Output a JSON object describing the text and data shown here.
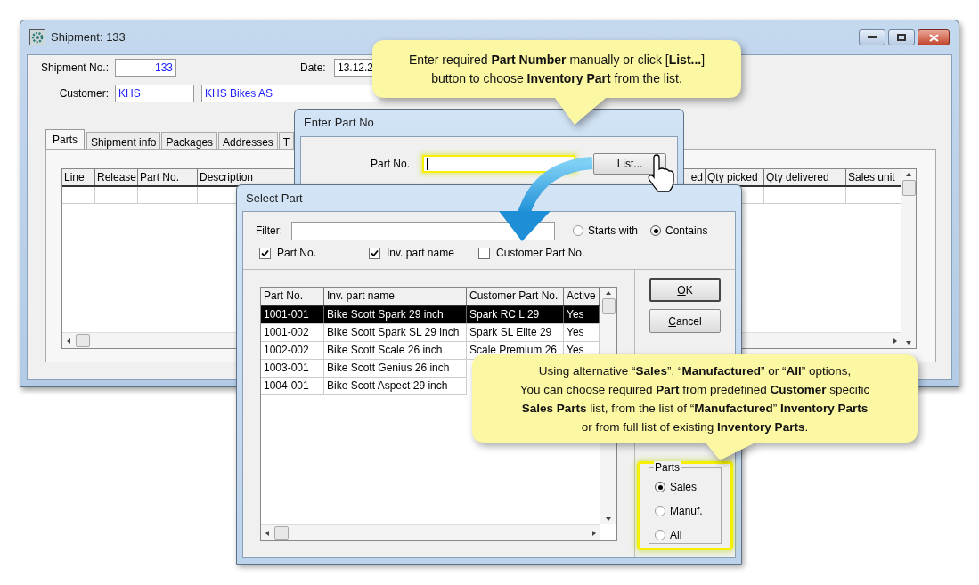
{
  "shipment_window": {
    "title": "Shipment: 133",
    "shipment_no": {
      "label": "Shipment No.:",
      "value": "133"
    },
    "date": {
      "label": "Date:",
      "value": "13.12.2"
    },
    "customer": {
      "label": "Customer:",
      "code": "KHS",
      "name": "KHS Bikes AS"
    },
    "tabs": [
      {
        "label": "Parts",
        "selected": true
      },
      {
        "label": "Shipment info",
        "selected": false
      },
      {
        "label": "Packages",
        "selected": false
      },
      {
        "label": "Addresses",
        "selected": false
      },
      {
        "label": "T",
        "selected": false
      }
    ],
    "table": {
      "columns": [
        "Line",
        "Release",
        "Part No.",
        "Description",
        "ed",
        "Qty picked",
        "Qty delivered",
        "Sales unit"
      ]
    }
  },
  "enter_part_dialog": {
    "title": "Enter Part No",
    "field_label": "Part No.",
    "list_button": "List..."
  },
  "select_part_dialog": {
    "title": "Select Part",
    "filter_label": "Filter:",
    "match_options": [
      {
        "label": "Starts with",
        "selected": false
      },
      {
        "label": "Contains",
        "selected": true
      }
    ],
    "search_in": [
      {
        "label": "Part No.",
        "checked": true
      },
      {
        "label": "Inv. part name",
        "checked": true
      },
      {
        "label": "Customer Part No.",
        "checked": false
      }
    ],
    "table": {
      "columns": [
        "Part No.",
        "Inv. part name",
        "Customer Part No.",
        "Active"
      ],
      "rows": [
        {
          "cells": [
            "1001-001",
            "Bike Scott Spark 29 inch",
            "Spark RC L 29",
            "Yes"
          ],
          "selected": true
        },
        {
          "cells": [
            "1001-002",
            "Bike Scott Spark SL 29 inch",
            "Spark SL Elite 29",
            "Yes"
          ],
          "selected": false
        },
        {
          "cells": [
            "1002-002",
            "Bike Scott Scale 26 inch",
            "Scale Premium 26",
            "Yes"
          ],
          "selected": false
        },
        {
          "cells": [
            "1003-001",
            "Bike Scott Genius 26 inch"
          ],
          "selected": false
        },
        {
          "cells": [
            "1004-001",
            "Bike Scott Aspect 29 inch"
          ],
          "selected": false
        }
      ]
    },
    "buttons": [
      "OK",
      "Cancel"
    ],
    "parts_group": {
      "title": "Parts",
      "options": [
        {
          "label": "Sales",
          "selected": true
        },
        {
          "label": "Manuf.",
          "selected": false
        },
        {
          "label": "All",
          "selected": false
        }
      ]
    }
  },
  "callouts": [
    {
      "lines": [
        "Enter required **Part Number** manually or click [**List...**]",
        "button to choose **Inventory Part** from the list."
      ]
    },
    {
      "lines": [
        "Using alternative “**Sales**”, “**Manufactured**” or “**All**” options,",
        "You can choose required **Part** from predefined **Customer** specific",
        "**Sales Parts** list, from the list of “**Manufactured**” **Inventory Parts**",
        "or from full list of existing **Inventory Parts**."
      ]
    }
  ]
}
